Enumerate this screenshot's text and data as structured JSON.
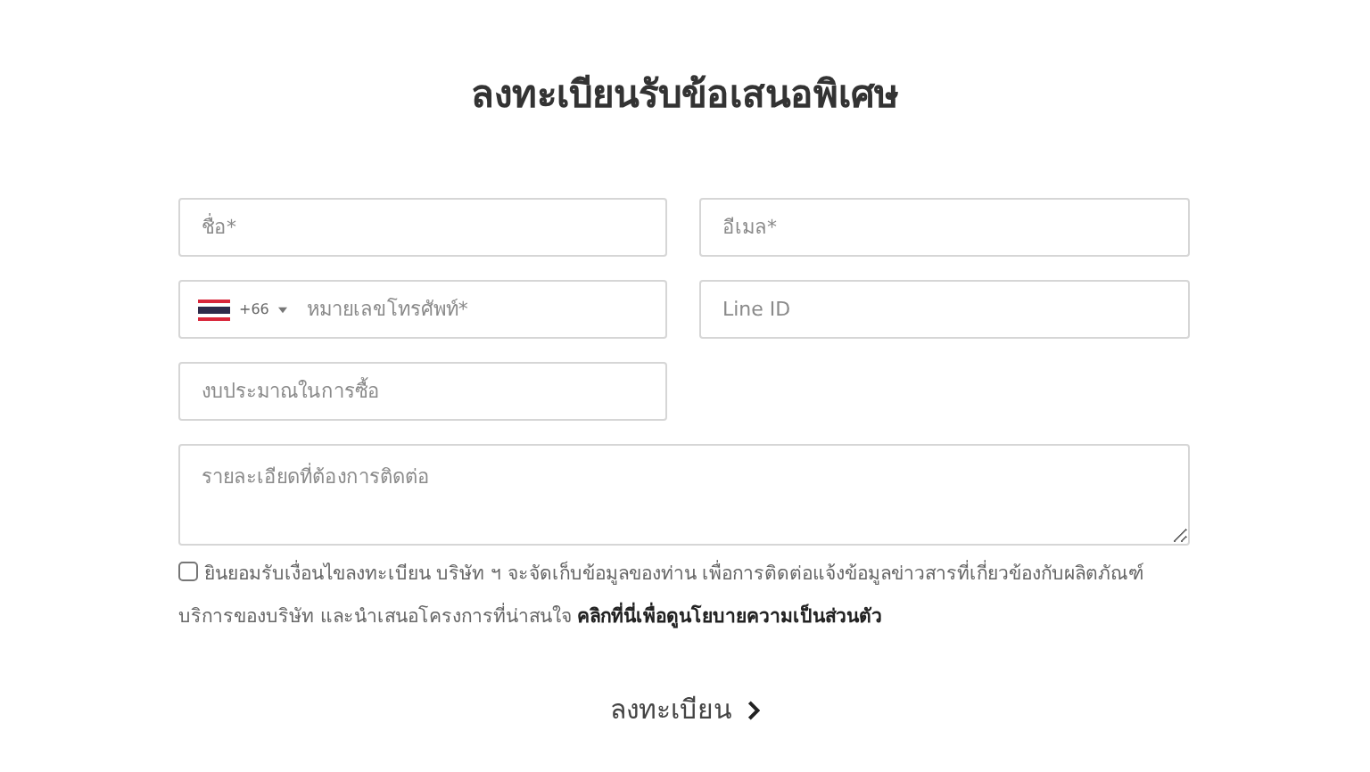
{
  "title": "ลงทะเบียนรับข้อเสนอพิเศษ",
  "fields": [
    {
      "kind": "text",
      "placeholder": "ชื่อ*"
    },
    {
      "kind": "text",
      "placeholder": "อีเมล*"
    },
    {
      "kind": "phone",
      "code": "+66",
      "placeholder": "หมายเลขโทรศัพท์*"
    },
    {
      "kind": "text",
      "placeholder": "Line ID"
    },
    {
      "kind": "text",
      "placeholder": "งบประมาณในการซื้อ"
    },
    {
      "kind": "textarea",
      "placeholder": "รายละเอียดที่ต้องการติดต่อ"
    }
  ],
  "consent": {
    "checked": false,
    "text": "ยินยอมรับเงื่อนไขลงทะเบียน บริษัท ฯ จะจัดเก็บข้อมูลของท่าน เพื่อการติดต่อแจ้งข้อมูลข่าวสารที่เกี่ยวข้องกับผลิตภัณฑ์ บริการของบริษัท และนำเสนอโครงการที่น่าสนใจ",
    "link": "คลิกที่นี่เพื่อดูนโยบายความเป็นส่วนตัว"
  },
  "submit": {
    "label": "ลงทะเบียน"
  }
}
